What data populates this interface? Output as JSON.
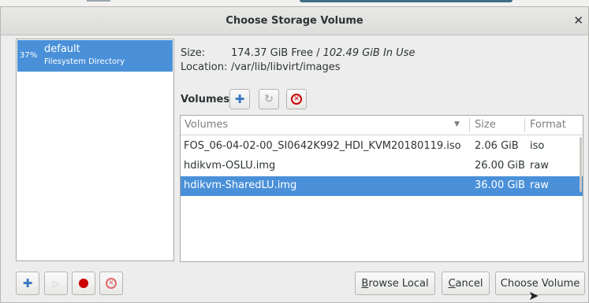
{
  "dialog": {
    "title": "Choose Storage Volume"
  },
  "pool_list": {
    "items": [
      {
        "percent": "37%",
        "name": "default",
        "type": "Filesystem Directory",
        "selected": true
      }
    ]
  },
  "details": {
    "size_label": "Size:",
    "size_free": "174.37 GiB Free",
    "size_separator": " / ",
    "size_in_use": "102.49 GiB In Use",
    "location_label": "Location:",
    "location_value": "/var/lib/libvirt/images"
  },
  "volumes_toolbar": {
    "title": "Volumes",
    "buttons": [
      "add-icon",
      "refresh-icon",
      "delete-icon"
    ]
  },
  "volumes_table": {
    "columns": [
      "Volumes",
      "Size",
      "Format"
    ],
    "rows": [
      {
        "name": "FOS_06-04-02-00_SI0642K992_HDI_KVM20180119.iso",
        "size": "2.06 GiB",
        "format": "iso",
        "selected": false
      },
      {
        "name": "hdikvm-OSLU.img",
        "size": "26.00 GiB",
        "format": "raw",
        "selected": false
      },
      {
        "name": "hdikvm-SharedLU.img",
        "size": "36.00 GiB",
        "format": "raw",
        "selected": true
      }
    ]
  },
  "pool_buttons": [
    "add-pool-icon",
    "start-pool-icon",
    "stop-pool-icon",
    "delete-pool-icon"
  ],
  "actions": {
    "browse_local": {
      "mnemonic": "B",
      "rest": "rowse Local"
    },
    "cancel": {
      "mnemonic": "C",
      "rest": "ancel"
    },
    "choose_volume": "Choose Volume"
  },
  "colors": {
    "selection": "#4a90d9",
    "accent_blue": "#3a78c2",
    "stop_red": "#cc0000"
  }
}
